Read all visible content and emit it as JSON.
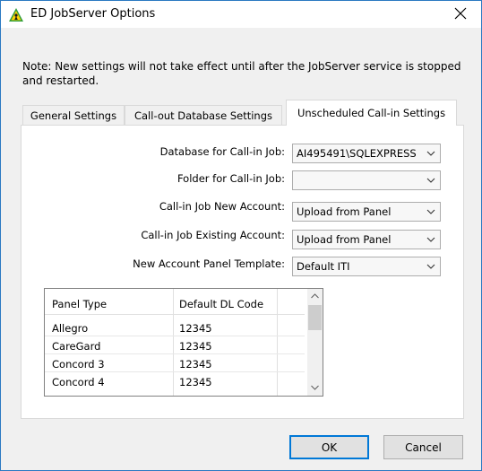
{
  "window": {
    "title": "ED JobServer Options"
  },
  "note": "Note: New settings will not take effect until after the JobServer service is stopped and restarted.",
  "tabs": [
    {
      "label": "General Settings",
      "active": false
    },
    {
      "label": "Call-out Database Settings",
      "active": false
    },
    {
      "label": "Unscheduled Call-in Settings",
      "active": true
    }
  ],
  "fields": [
    {
      "label": "Database for Call-in Job:",
      "value": "AI495491\\SQLEXPRESS"
    },
    {
      "label": "Folder for Call-in Job:",
      "value": ""
    },
    {
      "label": "Call-in Job New Account:",
      "value": "Upload from Panel"
    },
    {
      "label": "Call-in Job Existing Account:",
      "value": "Upload from Panel"
    },
    {
      "label": "New Account Panel Template:",
      "value": "Default ITI"
    }
  ],
  "table": {
    "columns": [
      "Panel Type",
      "Default DL Code"
    ],
    "rows": [
      [
        "Allegro",
        "12345"
      ],
      [
        "CareGard",
        "12345"
      ],
      [
        "Concord 3",
        "12345"
      ],
      [
        "Concord 4",
        "12345"
      ]
    ]
  },
  "buttons": {
    "ok": "OK",
    "cancel": "Cancel"
  },
  "colors": {
    "accent": "#0078d7",
    "window_border": "#2b79c2"
  }
}
